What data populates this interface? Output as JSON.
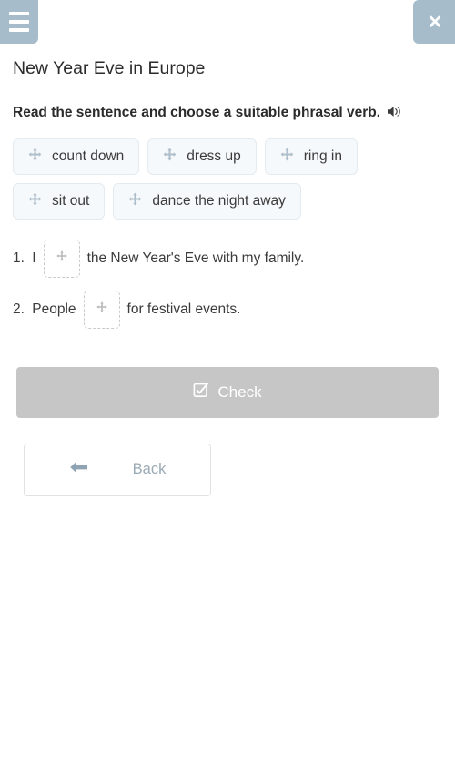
{
  "header": {
    "menu_icon": "hamburger-menu-icon",
    "close_icon": "close-icon",
    "close_label": "×"
  },
  "page": {
    "title": "New Year Eve in Europe",
    "instruction": "Read the sentence and choose a suitable phrasal verb.",
    "audio_icon": "speaker-icon"
  },
  "chips": [
    {
      "label": "count down",
      "icon": "move-icon"
    },
    {
      "label": "dress up",
      "icon": "move-icon"
    },
    {
      "label": "ring in",
      "icon": "move-icon"
    },
    {
      "label": "sit out",
      "icon": "move-icon"
    },
    {
      "label": "dance the night away",
      "icon": "move-icon"
    }
  ],
  "sentences": [
    {
      "number": "1.",
      "before": " I",
      "after": "the New Year's Eve with my family.",
      "dropzone_icon": "move-placeholder-icon",
      "dropzone_value": ""
    },
    {
      "number": "2.",
      "before": " People",
      "after": "for festival events.",
      "dropzone_icon": "move-placeholder-icon",
      "dropzone_value": ""
    }
  ],
  "actions": {
    "check_label": "Check",
    "check_icon": "check-square-icon",
    "back_label": "Back",
    "back_icon": "arrow-left-icon"
  },
  "colors": {
    "header_button": "#a6bcca",
    "chip_background": "#f6f9fb",
    "chip_border": "#e4ebf0",
    "check_button": "#c6c6c6",
    "back_text": "#9aaab5",
    "icon_gray_blue": "#aebecb"
  }
}
